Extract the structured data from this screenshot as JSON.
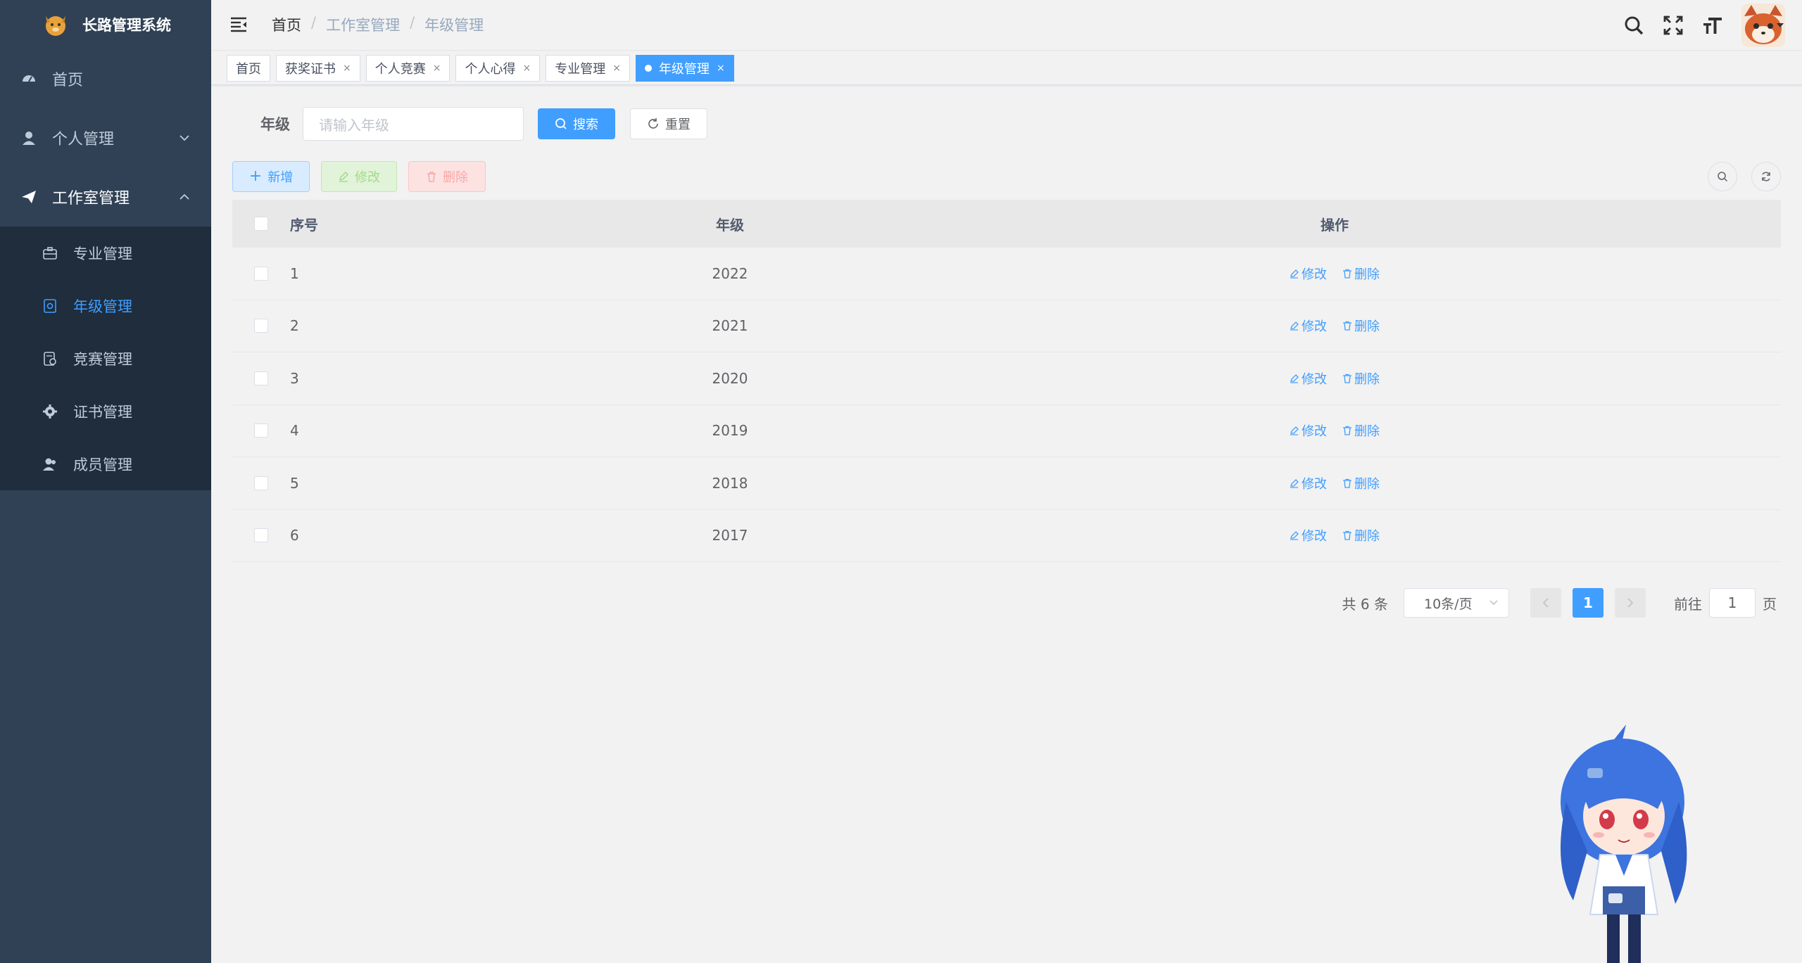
{
  "app": {
    "title": "长路管理系统"
  },
  "sidebar": {
    "items": [
      {
        "label": "首页",
        "icon": "dashboard-icon"
      },
      {
        "label": "个人管理",
        "icon": "user-icon"
      },
      {
        "label": "工作室管理",
        "icon": "paper-plane-icon"
      }
    ],
    "subitems": [
      {
        "label": "专业管理",
        "icon": "briefcase-icon"
      },
      {
        "label": "年级管理",
        "icon": "document-icon",
        "active": true
      },
      {
        "label": "竞赛管理",
        "icon": "contest-icon"
      },
      {
        "label": "证书管理",
        "icon": "gear-icon"
      },
      {
        "label": "成员管理",
        "icon": "members-icon"
      }
    ]
  },
  "navbar": {
    "breadcrumb": [
      "首页",
      "工作室管理",
      "年级管理"
    ]
  },
  "tags": [
    {
      "label": "首页",
      "closable": false
    },
    {
      "label": "获奖证书",
      "closable": true
    },
    {
      "label": "个人竞赛",
      "closable": true
    },
    {
      "label": "个人心得",
      "closable": true
    },
    {
      "label": "专业管理",
      "closable": true
    },
    {
      "label": "年级管理",
      "closable": true,
      "active": true
    }
  ],
  "search": {
    "label": "年级",
    "placeholder": "请输入年级",
    "search_btn": "搜索",
    "reset_btn": "重置"
  },
  "toolbar": {
    "add": "新增",
    "edit": "修改",
    "delete": "删除"
  },
  "table": {
    "headers": {
      "index": "序号",
      "grade": "年级",
      "ops": "操作"
    },
    "op_edit": "修改",
    "op_delete": "删除",
    "rows": [
      {
        "index": "1",
        "grade": "2022"
      },
      {
        "index": "2",
        "grade": "2021"
      },
      {
        "index": "3",
        "grade": "2020"
      },
      {
        "index": "4",
        "grade": "2019"
      },
      {
        "index": "5",
        "grade": "2018"
      },
      {
        "index": "6",
        "grade": "2017"
      }
    ]
  },
  "pagination": {
    "total": "共 6 条",
    "page_size": "10条/页",
    "current": "1",
    "goto_prefix": "前往",
    "goto_value": "1",
    "goto_suffix": "页"
  },
  "colors": {
    "primary": "#409eff",
    "sidebar": "#304156",
    "submenu": "#1f2d3d"
  }
}
